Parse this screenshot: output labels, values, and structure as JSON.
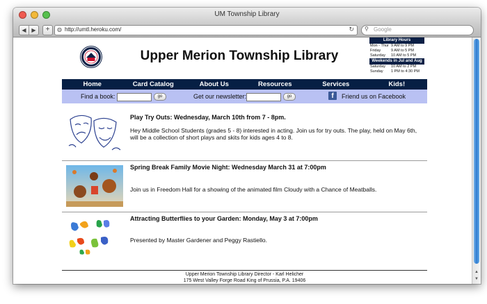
{
  "browser": {
    "window_title": "UM Township Library",
    "url": "http://umtl.heroku.com/",
    "search_placeholder": "Google",
    "back_glyph": "◀",
    "forward_glyph": "▶",
    "new_tab_glyph": "+",
    "reload_glyph": "↻"
  },
  "site": {
    "title": "Upper Merion Township Library",
    "logo_icon": "township-seal-icon"
  },
  "hours": {
    "heading": "Library Hours",
    "rows": [
      {
        "day": "Mon - Thur",
        "time": "9 AM to 9 PM"
      },
      {
        "day": "Friday",
        "time": "9 AM to 5 PM"
      },
      {
        "day": "Saturday",
        "time": "10 AM to 5 PM"
      }
    ],
    "summer_heading": "Weekends in Jul and Aug",
    "summer_rows": [
      {
        "day": "Saturday",
        "time": "10 AM to 2 PM"
      },
      {
        "day": "Sunday",
        "time": "1 PM to 4:30 PM"
      }
    ]
  },
  "menu": [
    "Home",
    "Card Catalog",
    "About Us",
    "Resources",
    "Services",
    "Kids!"
  ],
  "subbar": {
    "find_label": "Find a book:",
    "find_value": "",
    "go1": "go",
    "newsletter_label": "Get our newsletter:",
    "newsletter_value": "",
    "go2": "go",
    "facebook_text": "Friend us on Facebook",
    "facebook_glyph": "f"
  },
  "articles": [
    {
      "title": "Play Try Outs: Wednesday, March 10th from 7 - 8pm.",
      "body": "Hey Middle School Students (grades 5 - 8) interested in acting. Join us for try outs. The play, held on May 6th, will be a collection of short plays and skits for kids ages 4 to 8.",
      "image_icon": "theater-masks-icon"
    },
    {
      "title": "Spring Break Family Movie Night: Wednesday March 31 at 7:00pm",
      "body": "Join us in Freedom Hall for a showing of the animated film Cloudy with a Chance of Meatballs.",
      "image_icon": "movie-poster-icon"
    },
    {
      "title": "Attracting Butterflies to your Garden: Monday, May 3 at 7:00pm",
      "body": "Presented by Master Gardener and Peggy Rastiello.",
      "image_icon": "butterflies-icon"
    }
  ],
  "footer": {
    "line1": "Upper Merion Township Library Director - Karl Helicher",
    "line2": "175 West Valley Forge Road King of Prussia, P.A. 19406"
  }
}
